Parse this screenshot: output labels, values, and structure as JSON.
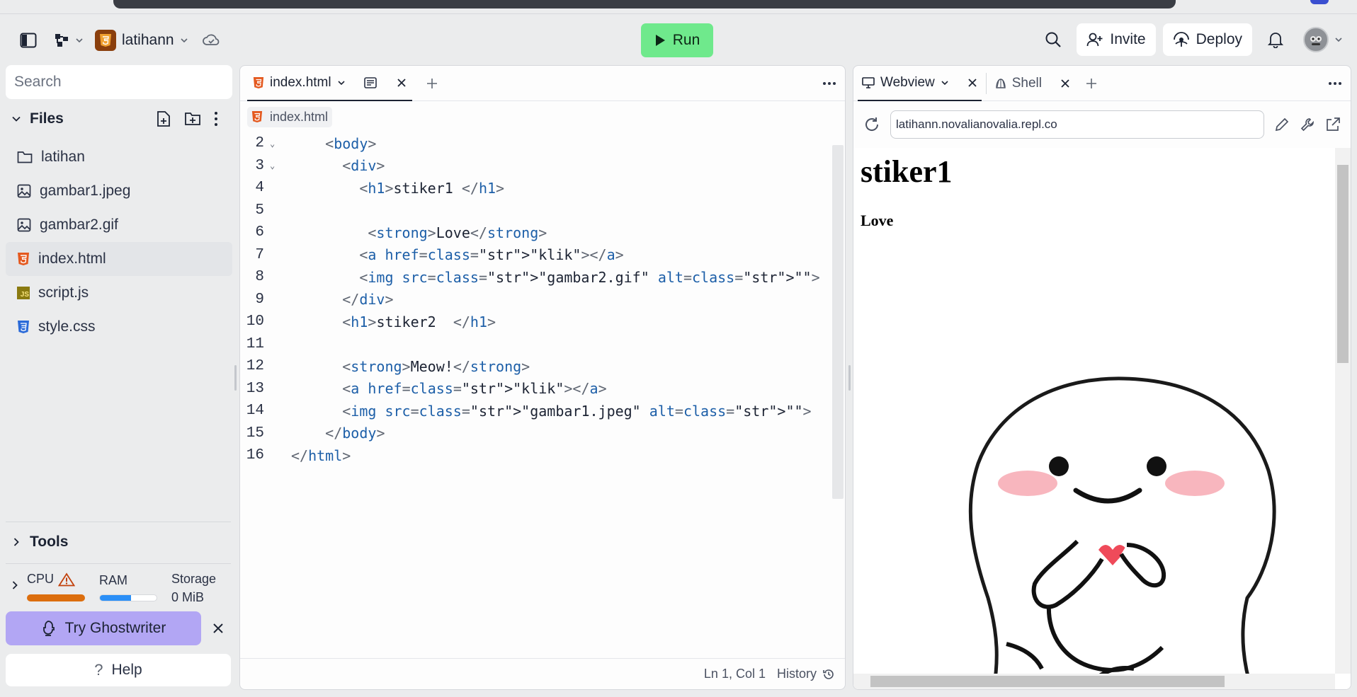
{
  "header": {
    "project_name": "latihann",
    "run_label": "Run",
    "invite_label": "Invite",
    "deploy_label": "Deploy"
  },
  "sidebar": {
    "search_placeholder": "Search",
    "files_title": "Files",
    "files": [
      {
        "name": "latihan",
        "icon": "folder-icon"
      },
      {
        "name": "gambar1.jpeg",
        "icon": "image-icon"
      },
      {
        "name": "gambar2.gif",
        "icon": "image-icon"
      },
      {
        "name": "index.html",
        "icon": "html-icon"
      },
      {
        "name": "script.js",
        "icon": "js-icon"
      },
      {
        "name": "style.css",
        "icon": "css-icon"
      }
    ],
    "tools_title": "Tools",
    "resources": {
      "cpu_label": "CPU",
      "ram_label": "RAM",
      "storage_label": "Storage",
      "storage_value": "0 MiB",
      "cpu_level": 1.0,
      "ram_level": 0.55
    },
    "ghostwriter_label": "Try Ghostwriter",
    "help_label": "Help"
  },
  "editor": {
    "tab_label": "index.html",
    "breadcrumb": "index.html",
    "status_position": "Ln 1, Col 1",
    "status_history": "History",
    "lines": [
      {
        "n": "2",
        "code": "    <body>"
      },
      {
        "n": "3",
        "code": "      <div>"
      },
      {
        "n": "4",
        "code": "        <h1>stiker1 </h1>"
      },
      {
        "n": "5",
        "code": ""
      },
      {
        "n": "6",
        "code": "         <strong>Love</strong>"
      },
      {
        "n": "7",
        "code": "        <a href=\"klik\"></a>"
      },
      {
        "n": "8",
        "code": "        <img src=\"gambar2.gif\" alt=\"\">"
      },
      {
        "n": "9",
        "code": "      </div>"
      },
      {
        "n": "10",
        "code": "      <h1>stiker2  </h1>"
      },
      {
        "n": "11",
        "code": ""
      },
      {
        "n": "12",
        "code": "      <strong>Meow!</strong>"
      },
      {
        "n": "13",
        "code": "      <a href=\"klik\"></a>"
      },
      {
        "n": "14",
        "code": "      <img src=\"gambar1.jpeg\" alt=\"\">"
      },
      {
        "n": "15",
        "code": "    </body>"
      },
      {
        "n": "16",
        "code": "</html>"
      }
    ]
  },
  "preview": {
    "tab_webview": "Webview",
    "tab_shell": "Shell",
    "url": "latihann.novalianovalia.repl.co",
    "page_heading": "stiker1",
    "page_strong": "Love"
  }
}
